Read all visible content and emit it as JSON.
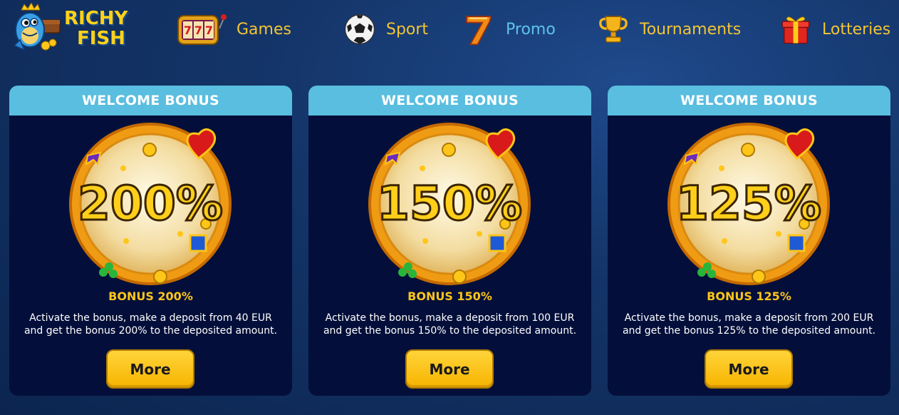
{
  "logo": {
    "line1": "RICHY",
    "line2": "FISH"
  },
  "nav": {
    "items": [
      {
        "label": "Games",
        "icon": "slot-machine-icon",
        "active": false
      },
      {
        "label": "Sport",
        "icon": "soccer-ball-icon",
        "active": false
      },
      {
        "label": "Promo",
        "icon": "lucky-seven-icon",
        "active": true
      },
      {
        "label": "Tournaments",
        "icon": "trophy-icon",
        "active": false
      },
      {
        "label": "Lotteries",
        "icon": "gift-box-icon",
        "active": false
      }
    ]
  },
  "cards": [
    {
      "header": "WELCOME BONUS",
      "wheel_text": "200%",
      "title": "BONUS 200%",
      "desc_line1": "Activate the bonus, make a deposit from 40 EUR",
      "desc_line2": "and get the bonus 200% to the deposited amount.",
      "button": "More"
    },
    {
      "header": "WELCOME BONUS",
      "wheel_text": "150%",
      "title": "BONUS 150%",
      "desc_line1": "Activate the bonus, make a deposit from 100 EUR",
      "desc_line2": "and get the bonus 150% to the deposited amount.",
      "button": "More"
    },
    {
      "header": "WELCOME BONUS",
      "wheel_text": "125%",
      "title": "BONUS 125%",
      "desc_line1": "Activate the bonus, make a deposit from 200 EUR",
      "desc_line2": "and get the bonus 125% to the deposited amount.",
      "button": "More"
    }
  ],
  "colors": {
    "nav_text": "#f3c534",
    "nav_active": "#5ec3ea",
    "card_bg": "#030f3a",
    "card_header": "#59bee0",
    "bonus_title": "#ffc61a",
    "button": "#ffcc1a"
  }
}
